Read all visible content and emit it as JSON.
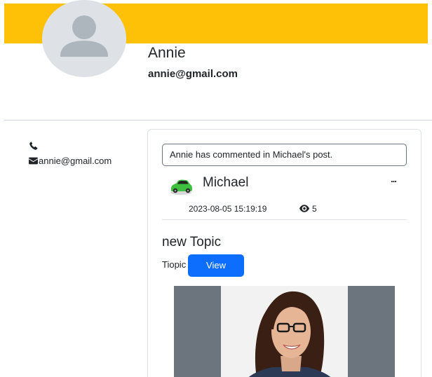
{
  "profile": {
    "name": "Annie",
    "email": "annie@gmail.com"
  },
  "sidebar": {
    "phone_icon": "phone-icon",
    "email_icon": "envelope-icon",
    "email": "annie@gmail.com"
  },
  "post": {
    "notice": "Annie has commented in Michael's post.",
    "author_icon": "green-car-icon",
    "author": "Michael",
    "more_label": "...",
    "date": "2023-08-05 15:19:19",
    "view_icon": "eye-icon",
    "views": "5",
    "title": "new Topic",
    "body": "Tiopic",
    "view_button": "View"
  },
  "colors": {
    "banner": "#ffc107",
    "button": "#0d6efd",
    "image_frame": "#6c757d"
  }
}
